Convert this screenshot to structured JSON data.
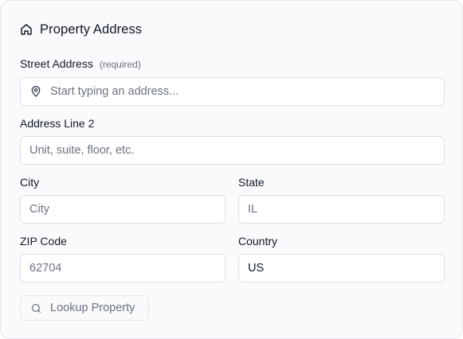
{
  "section": {
    "title": "Property Address",
    "icon": "home-icon"
  },
  "street": {
    "label": "Street Address",
    "hint": "(required)",
    "placeholder": "Start typing an address...",
    "value": "",
    "icon": "map-pin-icon"
  },
  "line2": {
    "label": "Address Line 2",
    "placeholder": "Unit, suite, floor, etc.",
    "value": ""
  },
  "city": {
    "label": "City",
    "placeholder": "City",
    "value": ""
  },
  "state": {
    "label": "State",
    "placeholder": "IL",
    "value": ""
  },
  "zip": {
    "label": "ZIP Code",
    "placeholder": "62704",
    "value": ""
  },
  "country": {
    "label": "Country",
    "value": "US"
  },
  "lookup": {
    "label": "Lookup Property",
    "icon": "search-icon"
  },
  "colors": {
    "text": "#111827",
    "muted": "#6b7280",
    "border": "#dfe1e6",
    "card": "#fafafc"
  }
}
